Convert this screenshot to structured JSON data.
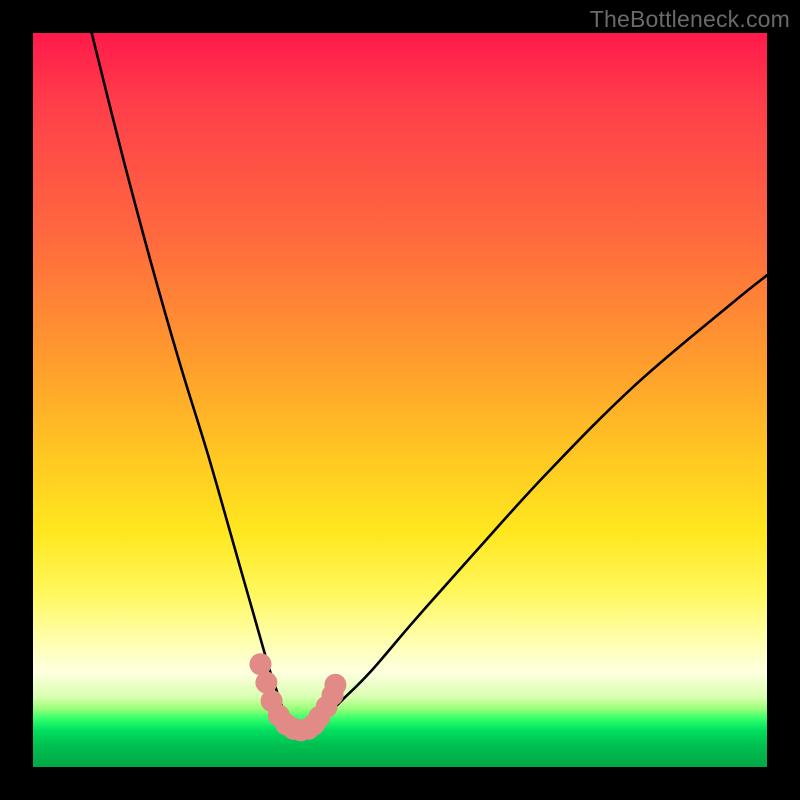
{
  "watermark": "TheBottleneck.com",
  "chart_data": {
    "type": "line",
    "title": "",
    "xlabel": "",
    "ylabel": "",
    "xlim": [
      0,
      100
    ],
    "ylim": [
      0,
      100
    ],
    "series": [
      {
        "name": "bottleneck-curve",
        "x": [
          8,
          12,
          16,
          20,
          24,
          28,
          30,
          32,
          33,
          34,
          35,
          36,
          37,
          38,
          39,
          40,
          42,
          46,
          52,
          60,
          70,
          82,
          95,
          100
        ],
        "values": [
          100,
          84,
          69,
          55,
          42,
          28,
          21,
          14,
          11,
          8,
          6,
          5,
          5,
          5,
          6,
          7,
          9,
          13,
          20,
          29,
          40,
          52,
          63,
          67
        ]
      }
    ],
    "markers": {
      "name": "highlight-dots",
      "color": "#e28a86",
      "points_xy": [
        [
          31.0,
          14.0
        ],
        [
          31.8,
          11.5
        ],
        [
          32.5,
          9.0
        ],
        [
          33.5,
          7.0
        ],
        [
          34.5,
          5.8
        ],
        [
          35.5,
          5.2
        ],
        [
          36.5,
          5.0
        ],
        [
          37.5,
          5.2
        ],
        [
          38.3,
          5.8
        ],
        [
          39.0,
          6.8
        ],
        [
          40.0,
          8.2
        ],
        [
          40.8,
          9.8
        ],
        [
          41.2,
          11.2
        ]
      ]
    }
  }
}
